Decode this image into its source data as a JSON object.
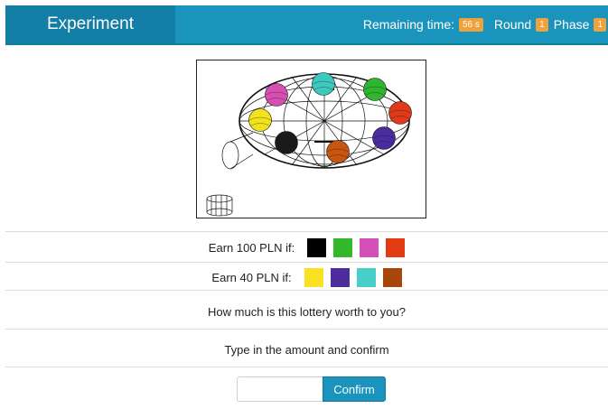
{
  "header": {
    "title": "Experiment",
    "remaining_label": "Remaining time:",
    "remaining_value": "56 s",
    "round_label": "Round",
    "round_value": "1",
    "phase_label": "Phase",
    "phase_value": "1"
  },
  "lottery": {
    "balls": [
      {
        "name": "magenta-ball",
        "color": "#d84fb3"
      },
      {
        "name": "teal-ball",
        "color": "#3cc9c0"
      },
      {
        "name": "green-ball",
        "color": "#2fb52f"
      },
      {
        "name": "red-ball",
        "color": "#e13a1b"
      },
      {
        "name": "purple-ball",
        "color": "#4a2ba0"
      },
      {
        "name": "orange-ball",
        "color": "#c85510"
      },
      {
        "name": "black-ball",
        "color": "#1a1a1a"
      },
      {
        "name": "yellow-ball",
        "color": "#f1e21c"
      }
    ]
  },
  "earn100": {
    "label": "Earn 100 PLN if:",
    "colors": [
      "#000000",
      "#33b72b",
      "#d450b9",
      "#e33b14"
    ]
  },
  "earn40": {
    "label": "Earn 40 PLN if:",
    "colors": [
      "#fae123",
      "#4d2c9c",
      "#48cfc8",
      "#a8470c"
    ]
  },
  "question": "How much is this lottery worth to you?",
  "instruction": "Type in the amount and confirm",
  "form": {
    "amount_value": "",
    "confirm_label": "Confirm"
  }
}
